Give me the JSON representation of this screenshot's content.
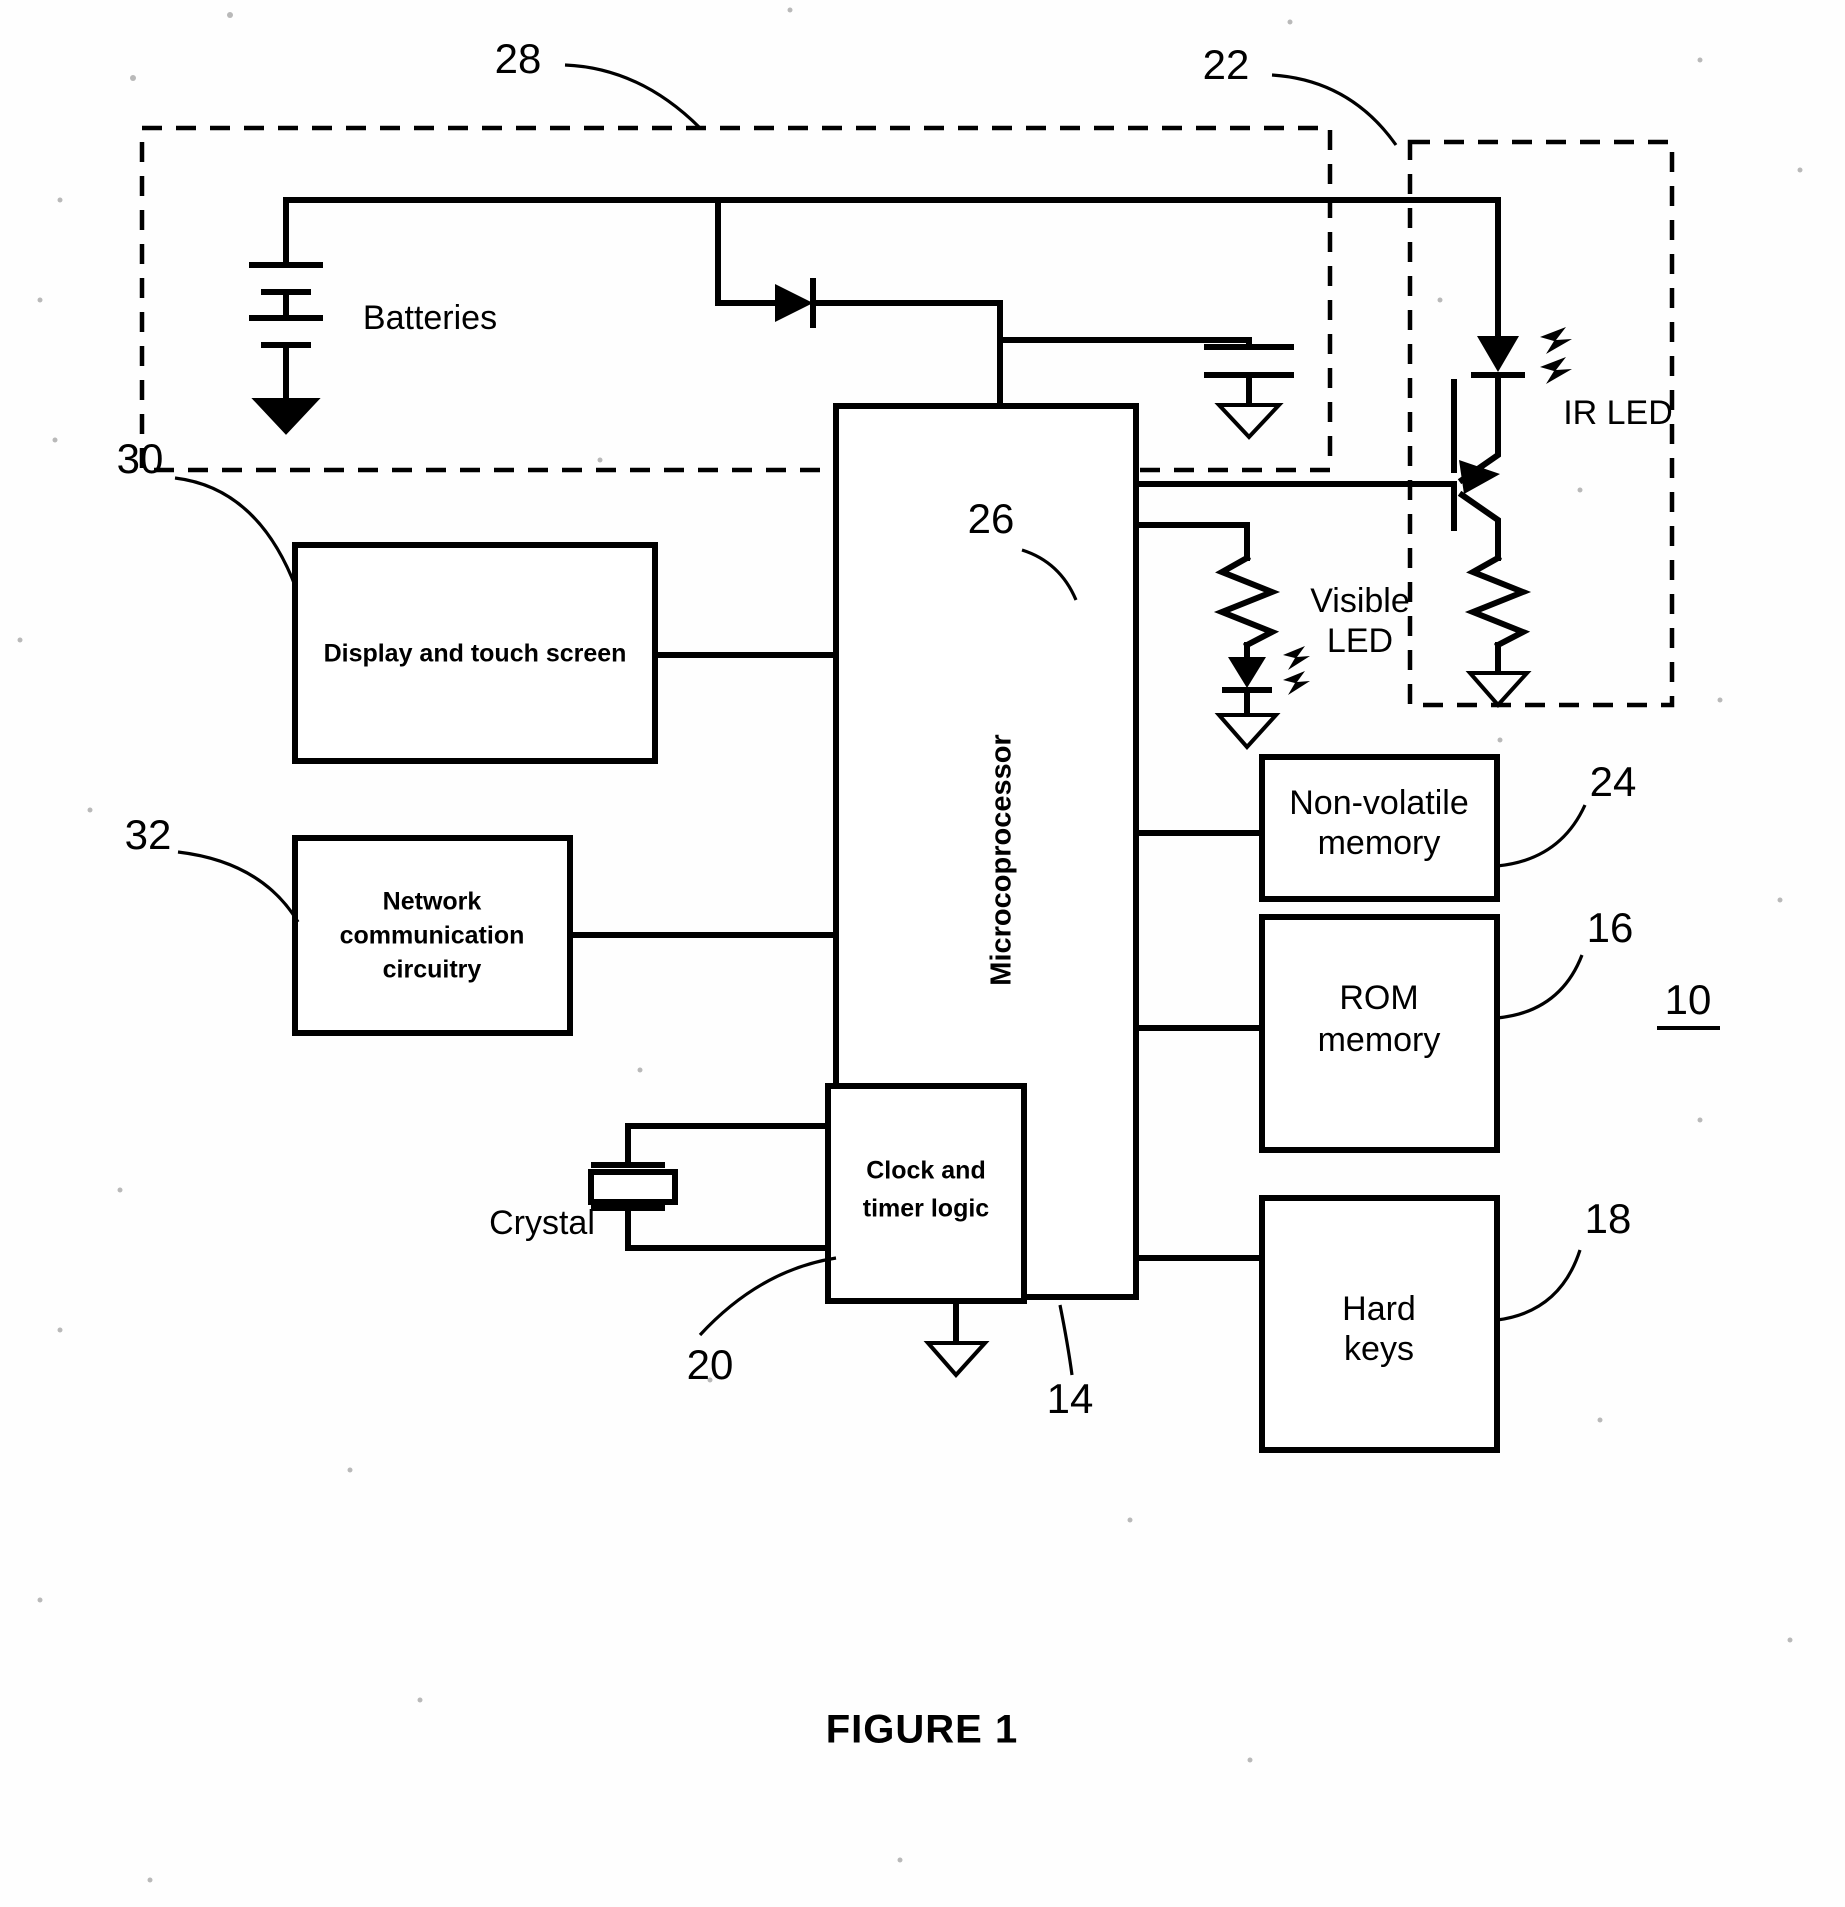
{
  "figure": {
    "caption": "FIGURE 1",
    "system_ref": "10"
  },
  "blocks": [
    {
      "id": "display",
      "label_lines": [
        "Display and touch screen"
      ],
      "ref": "30"
    },
    {
      "id": "network",
      "label_lines": [
        "Network",
        "communication",
        "circuitry"
      ],
      "ref": "32"
    },
    {
      "id": "micro",
      "label_lines": [
        "Microcoprocessor"
      ],
      "ref": "14"
    },
    {
      "id": "clock",
      "label_lines": [
        "Clock and",
        "timer logic"
      ],
      "ref": "20"
    },
    {
      "id": "nvmemory",
      "label_lines": [
        "Non-volatile",
        "memory"
      ],
      "ref": "24"
    },
    {
      "id": "rom",
      "label_lines": [
        "ROM",
        "memory"
      ],
      "ref": "16"
    },
    {
      "id": "hardkeys",
      "label_lines": [
        "Hard",
        "keys"
      ],
      "ref": "18"
    }
  ],
  "components": {
    "batteries_label": "Batteries",
    "crystal_label": "Crystal",
    "ir_led_label": "IR LED",
    "visible_led_label_lines": [
      "Visible",
      "LED"
    ]
  },
  "dashed_regions": [
    {
      "id": "power-supply-region",
      "ref": "28"
    },
    {
      "id": "ir-emitter-region",
      "ref": "22"
    }
  ],
  "reference_numerals": {
    "power_supply": "28",
    "ir_emitter": "22",
    "visible_led": "26",
    "nonvolatile_memory": "24",
    "rom_memory": "16",
    "hard_keys": "18",
    "display": "30",
    "network": "32",
    "clock_timer": "20",
    "microprocessor": "14",
    "system": "10"
  },
  "colors": {
    "ink": "#000000",
    "paper": "#ffffff"
  }
}
